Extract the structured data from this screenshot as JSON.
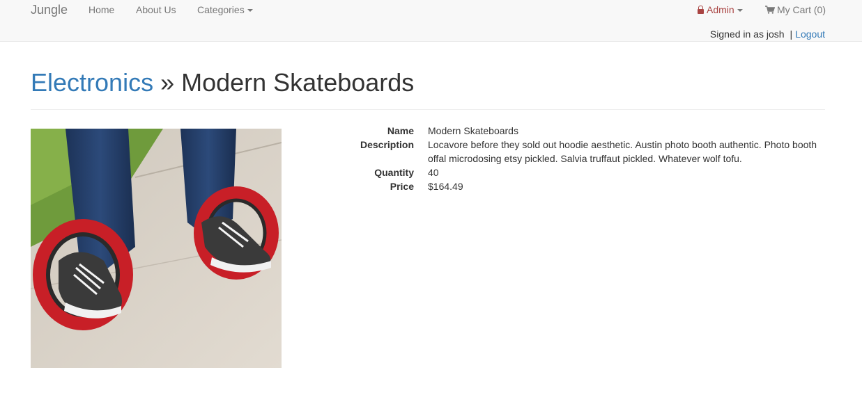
{
  "navbar": {
    "brand": "Jungle",
    "links": {
      "home": "Home",
      "about": "About Us",
      "categories": "Categories"
    },
    "admin": "Admin",
    "cart": "My Cart (0)",
    "signed_in": "Signed in as josh",
    "separator": "|",
    "logout": "Logout"
  },
  "header": {
    "category": "Electronics",
    "separator": " » ",
    "product": "Modern Skateboards"
  },
  "product": {
    "image_alt": "modern-skateboards-image",
    "fields": [
      {
        "label": "Name",
        "value": "Modern Skateboards"
      },
      {
        "label": "Description",
        "value": "Locavore before they sold out hoodie aesthetic. Austin photo booth authentic. Photo booth offal microdosing etsy pickled. Salvia truffaut pickled. Whatever wolf tofu."
      },
      {
        "label": "Quantity",
        "value": "40"
      },
      {
        "label": "Price",
        "value": "$164.49"
      }
    ]
  },
  "icons": {
    "admin": "lock-icon",
    "cart": "shopping-cart-icon",
    "dropdown": "caret-down-icon"
  },
  "colors": {
    "link": "#337ab7",
    "admin": "#a94442",
    "navbar_bg": "#f8f8f8",
    "nav_text": "#777777"
  }
}
